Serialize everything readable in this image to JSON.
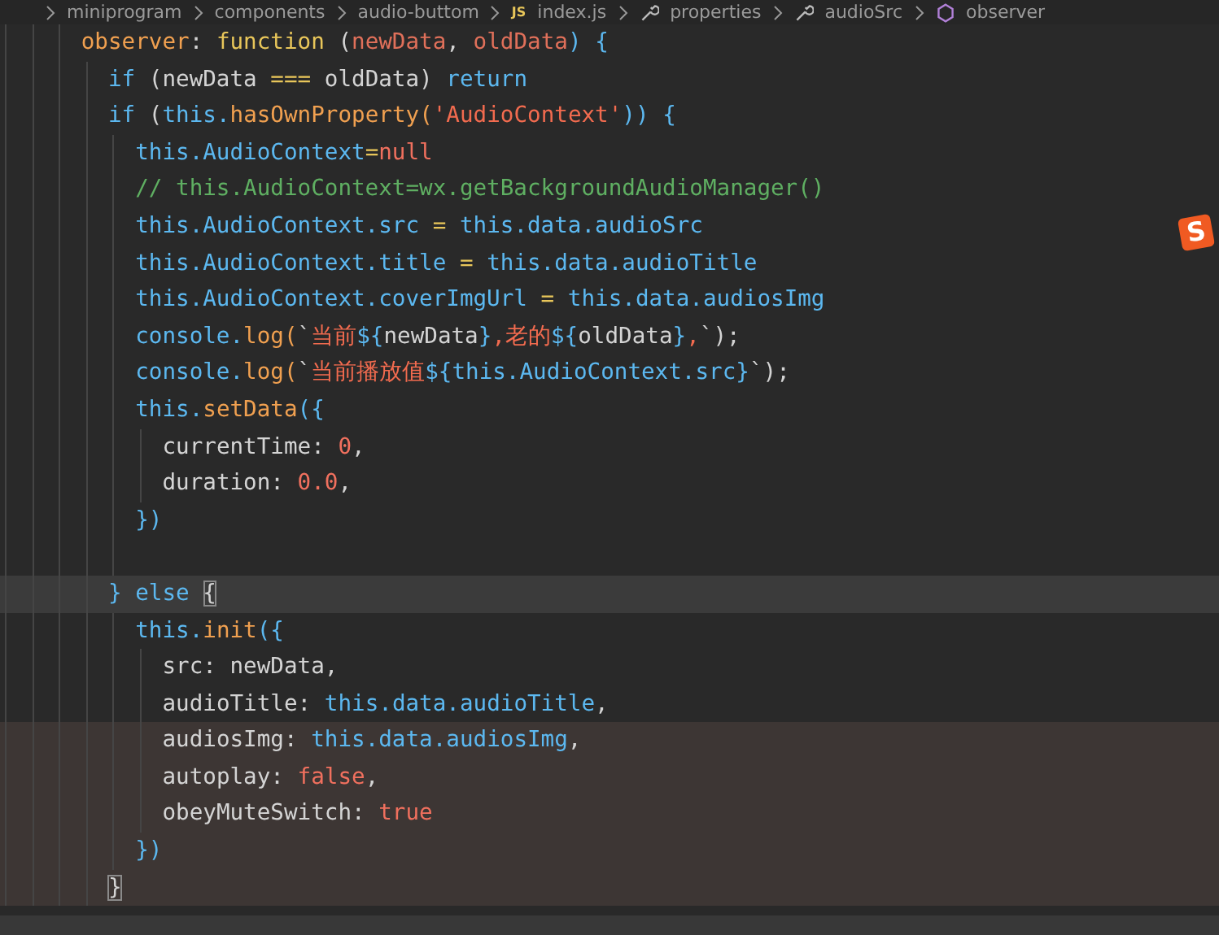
{
  "breadcrumb": [
    {
      "text": "miniprogram",
      "kind": "folder"
    },
    {
      "text": "components",
      "kind": "folder"
    },
    {
      "text": "audio-buttom",
      "kind": "folder"
    },
    {
      "text": "index.js",
      "kind": "file",
      "badge": "JS"
    },
    {
      "text": "properties",
      "kind": "property"
    },
    {
      "text": "audioSrc",
      "kind": "property"
    },
    {
      "text": "observer",
      "kind": "method"
    }
  ],
  "logo": {
    "text": "S"
  },
  "lines": [
    {
      "tokens": [
        {
          "t": "observer",
          "kind": "function"
        },
        {
          "t": ": ",
          "kind": "plain"
        },
        {
          "t": "function",
          "kind": "operator"
        },
        {
          "t": " (",
          "kind": "plain"
        },
        {
          "t": "newData",
          "kind": "param"
        },
        {
          "t": ", ",
          "kind": "plain"
        },
        {
          "t": "oldData",
          "kind": "param"
        },
        {
          "t": ") {",
          "kind": "keyword"
        }
      ],
      "children": [
        {
          "tokens": [
            {
              "t": "if",
              "kind": "keyword"
            },
            {
              "t": " (newData ",
              "kind": "plain"
            },
            {
              "t": "===",
              "kind": "operator"
            },
            {
              "t": " oldData) ",
              "kind": "plain"
            },
            {
              "t": "return",
              "kind": "keyword"
            }
          ]
        },
        {
          "tokens": [
            {
              "t": "if",
              "kind": "keyword"
            },
            {
              "t": " (",
              "kind": "plain"
            },
            {
              "t": "this.",
              "kind": "keyword"
            },
            {
              "t": "hasOwnProperty",
              "kind": "function"
            },
            {
              "t": "(",
              "kind": "function"
            },
            {
              "t": "'AudioContext'",
              "kind": "string"
            },
            {
              "t": ")) {",
              "kind": "keyword"
            }
          ],
          "children": [
            {
              "tokens": [
                {
                  "t": "this.AudioContext",
                  "kind": "keyword"
                },
                {
                  "t": "=",
                  "kind": "operator"
                },
                {
                  "t": "null",
                  "kind": "number"
                }
              ]
            },
            {
              "tokens": [
                {
                  "t": "// this.AudioContext=wx.getBackgroundAudioManager()",
                  "kind": "comment"
                }
              ]
            },
            {
              "tokens": [
                {
                  "t": "this.AudioContext.src ",
                  "kind": "keyword"
                },
                {
                  "t": "=",
                  "kind": "operator"
                },
                {
                  "t": " this.data.audioSrc",
                  "kind": "keyword"
                }
              ]
            },
            {
              "tokens": [
                {
                  "t": "this.AudioContext.title ",
                  "kind": "keyword"
                },
                {
                  "t": "=",
                  "kind": "operator"
                },
                {
                  "t": " this.data.audioTitle",
                  "kind": "keyword"
                }
              ]
            },
            {
              "tokens": [
                {
                  "t": "this.AudioContext.coverImgUrl ",
                  "kind": "keyword"
                },
                {
                  "t": "=",
                  "kind": "operator"
                },
                {
                  "t": " this.data.audiosImg",
                  "kind": "keyword"
                }
              ]
            },
            {
              "tokens": [
                {
                  "t": "console.",
                  "kind": "keyword"
                },
                {
                  "t": "log",
                  "kind": "function"
                },
                {
                  "t": "(",
                  "kind": "function"
                },
                {
                  "t": "`",
                  "kind": "plain"
                },
                {
                  "t": "当前",
                  "kind": "string"
                },
                {
                  "t": "${",
                  "kind": "keyword"
                },
                {
                  "t": "newData",
                  "kind": "plain"
                },
                {
                  "t": "}",
                  "kind": "keyword"
                },
                {
                  "t": ",老的",
                  "kind": "string"
                },
                {
                  "t": "${",
                  "kind": "keyword"
                },
                {
                  "t": "oldData",
                  "kind": "plain"
                },
                {
                  "t": "}",
                  "kind": "keyword"
                },
                {
                  "t": ",",
                  "kind": "string"
                },
                {
                  "t": "`);",
                  "kind": "plain"
                }
              ]
            },
            {
              "tokens": [
                {
                  "t": "console.",
                  "kind": "keyword"
                },
                {
                  "t": "log",
                  "kind": "function"
                },
                {
                  "t": "(",
                  "kind": "function"
                },
                {
                  "t": "`",
                  "kind": "plain"
                },
                {
                  "t": "当前播放值",
                  "kind": "string"
                },
                {
                  "t": "${this.AudioContext.src}",
                  "kind": "keyword"
                },
                {
                  "t": "`);",
                  "kind": "plain"
                }
              ]
            },
            {
              "tokens": [
                {
                  "t": "this.",
                  "kind": "keyword"
                },
                {
                  "t": "setData",
                  "kind": "function"
                },
                {
                  "t": "({",
                  "kind": "keyword"
                }
              ],
              "children": [
                {
                  "tokens": [
                    {
                      "t": "currentTime: ",
                      "kind": "plain"
                    },
                    {
                      "t": "0",
                      "kind": "number"
                    },
                    {
                      "t": ",",
                      "kind": "plain"
                    }
                  ]
                },
                {
                  "tokens": [
                    {
                      "t": "duration: ",
                      "kind": "plain"
                    },
                    {
                      "t": "0.0",
                      "kind": "number"
                    },
                    {
                      "t": ",",
                      "kind": "plain"
                    }
                  ]
                }
              ]
            },
            {
              "tokens": [
                {
                  "t": "})",
                  "kind": "keyword"
                }
              ]
            },
            {
              "kind": "blank"
            }
          ]
        },
        {
          "current": true,
          "tokens": [
            {
              "t": "} else ",
              "kind": "keyword"
            },
            {
              "t": "{",
              "kind": "bracket-match"
            }
          ],
          "children": [
            {
              "tokens": [
                {
                  "t": "this.",
                  "kind": "keyword"
                },
                {
                  "t": "init",
                  "kind": "function"
                },
                {
                  "t": "({",
                  "kind": "keyword"
                }
              ],
              "children": [
                {
                  "tokens": [
                    {
                      "t": "src: newData,",
                      "kind": "plain"
                    }
                  ]
                },
                {
                  "tokens": [
                    {
                      "t": "audioTitle: ",
                      "kind": "plain"
                    },
                    {
                      "t": "this.data.audioTitle",
                      "kind": "keyword"
                    },
                    {
                      "t": ",",
                      "kind": "plain"
                    }
                  ]
                },
                {
                  "changed": true,
                  "tokens": [
                    {
                      "t": "audiosImg: ",
                      "kind": "plain"
                    },
                    {
                      "t": "this.data.audiosImg",
                      "kind": "keyword"
                    },
                    {
                      "t": ",",
                      "kind": "plain"
                    }
                  ]
                },
                {
                  "changed": true,
                  "tokens": [
                    {
                      "t": "autoplay: ",
                      "kind": "plain"
                    },
                    {
                      "t": "false",
                      "kind": "number"
                    },
                    {
                      "t": ",",
                      "kind": "plain"
                    }
                  ]
                },
                {
                  "changed": true,
                  "tokens": [
                    {
                      "t": "obeyMuteSwitch: ",
                      "kind": "plain"
                    },
                    {
                      "t": "true",
                      "kind": "number"
                    }
                  ]
                }
              ]
            },
            {
              "changed": true,
              "tokens": [
                {
                  "t": "})",
                  "kind": "keyword"
                }
              ]
            }
          ]
        },
        {
          "changed": true,
          "tokens": [
            {
              "t": "}",
              "kind": "bracket-match"
            }
          ]
        }
      ]
    }
  ]
}
